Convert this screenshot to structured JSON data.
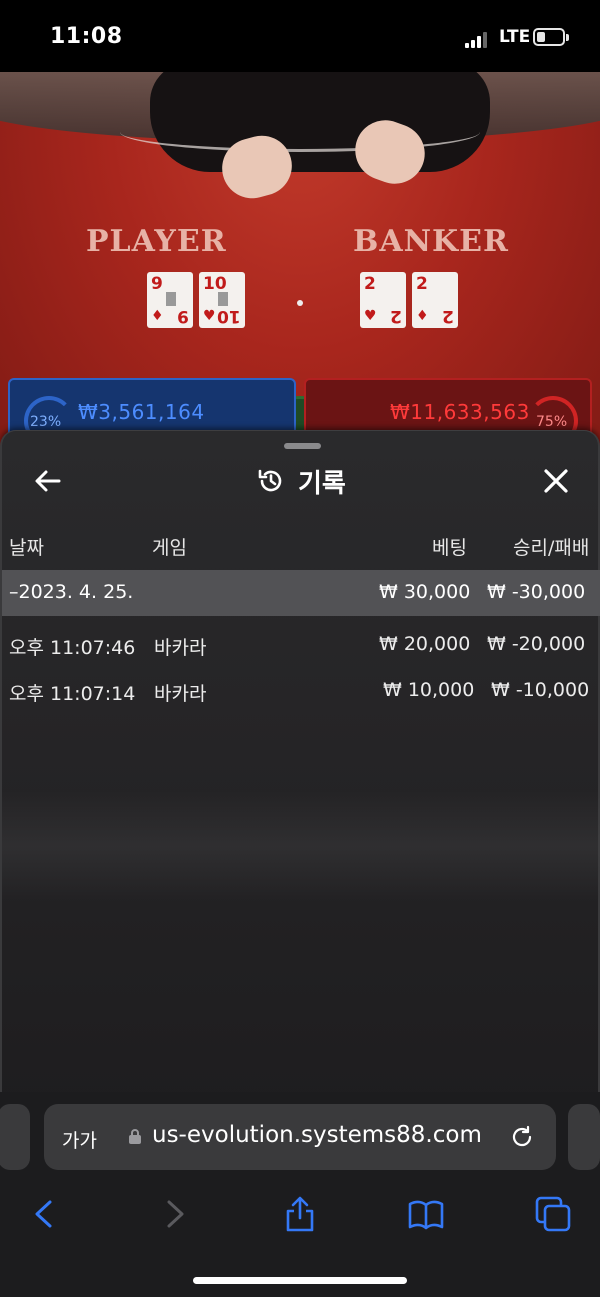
{
  "status_bar": {
    "time": "11:08",
    "network": "LTE"
  },
  "table": {
    "player_label": "PLAYER",
    "banker_label": "BANKER",
    "player_cards": [
      "9",
      "10"
    ],
    "banker_cards": [
      "2",
      "2"
    ],
    "player_bet": {
      "percent": "23%",
      "amount": "₩3,561,164"
    },
    "banker_bet": {
      "percent": "75%",
      "amount": "₩11,633,563"
    }
  },
  "history": {
    "title": "기록",
    "columns": {
      "date": "날짜",
      "game": "게임",
      "bet": "베팅",
      "result": "승리/패배"
    },
    "summary": {
      "date": "–2023. 4. 25.",
      "bet": "₩ 30,000",
      "result": "₩ -30,000"
    },
    "rows": [
      {
        "time": "오후 11:07:46",
        "game": "바카라",
        "bet": "₩ 20,000",
        "result": "₩ -20,000"
      },
      {
        "time": "오후 11:07:14",
        "game": "바카라",
        "bet": "₩ 10,000",
        "result": "₩ -10,000"
      }
    ]
  },
  "browser": {
    "text_size_label": "가가",
    "url": "us-evolution.systems88.com"
  },
  "colors": {
    "accent": "#3478f6",
    "player_blue": "#2d64c8",
    "banker_red": "#b32020"
  }
}
